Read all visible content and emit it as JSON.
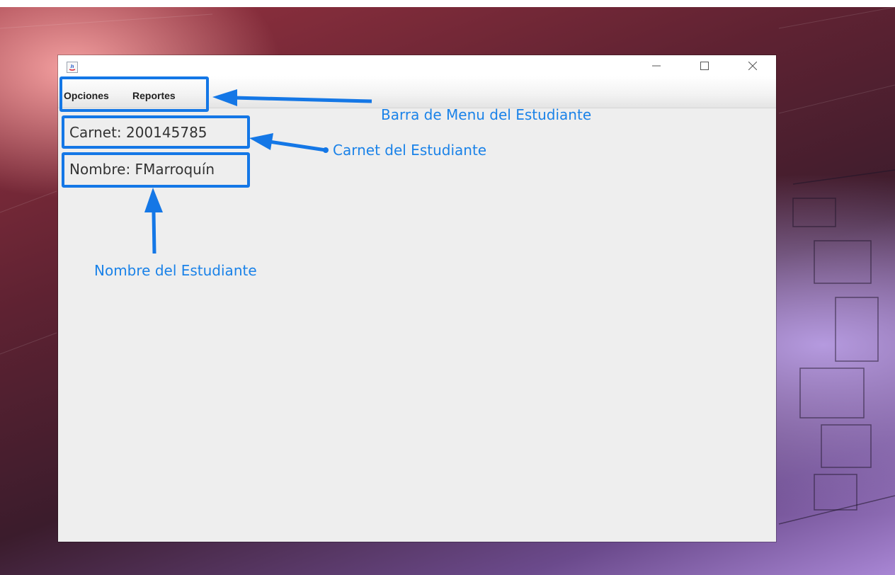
{
  "window": {
    "menu": [
      "Opciones",
      "Reportes"
    ],
    "carnet_label": "Carnet: 200145785",
    "nombre_label": "Nombre: FMarroquín"
  },
  "annotations": {
    "menubar_note": "Barra de Menu del Estudiante",
    "carnet_note": "Carnet del Estudiante",
    "nombre_note": "Nombre del Estudiante"
  },
  "colors": {
    "highlight": "#1477e6",
    "annotation_text": "#1a82e8"
  },
  "icons": {
    "app": "java-app-icon",
    "minimize": "minimize-icon",
    "maximize": "maximize-icon",
    "close": "close-icon"
  }
}
